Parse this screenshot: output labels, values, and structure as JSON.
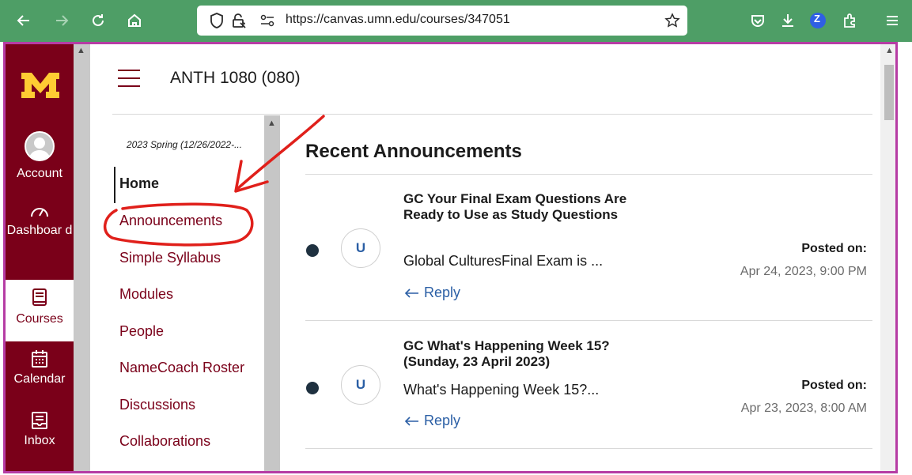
{
  "browser": {
    "url": "https://canvas.umn.edu/courses/347051",
    "profile_initial": "Z"
  },
  "global_nav": {
    "items": [
      {
        "label": "Account"
      },
      {
        "label": "Dashboar d"
      },
      {
        "label": "Courses"
      },
      {
        "label": "Calendar"
      },
      {
        "label": "Inbox"
      }
    ],
    "active": "Courses"
  },
  "header": {
    "breadcrumb": "ANTH 1080 (080)"
  },
  "course_nav": {
    "term": "2023 Spring (12/26/2022-...",
    "items": [
      {
        "label": "Home"
      },
      {
        "label": "Announcements"
      },
      {
        "label": "Simple Syllabus"
      },
      {
        "label": "Modules"
      },
      {
        "label": "People"
      },
      {
        "label": "NameCoach Roster"
      },
      {
        "label": "Discussions"
      },
      {
        "label": "Collaborations"
      }
    ]
  },
  "main": {
    "title": "Recent Announcements",
    "announcements": [
      {
        "avatar_initial": "U",
        "title": "GC Your Final Exam Questions Are Ready to Use as Study Questions",
        "excerpt": "Global CulturesFinal Exam is ...",
        "reply_label": "Reply",
        "posted_label": "Posted on:",
        "posted_date": "Apr 24, 2023, 9:00 PM"
      },
      {
        "avatar_initial": "U",
        "title": "GC What's Happening Week 15? (Sunday, 23 April 2023)",
        "excerpt": "What's Happening Week 15?...",
        "reply_label": "Reply",
        "posted_label": "Posted on:",
        "posted_date": "Apr 23, 2023, 8:00 AM"
      }
    ]
  },
  "colors": {
    "brand_maroon": "#7a0019",
    "brand_gold": "#ffcc33",
    "toolbar_green": "#4e9e66",
    "link_blue": "#2b5fa5",
    "annotation_red": "#e0201b",
    "frame_magenta": "#b63ca4"
  }
}
